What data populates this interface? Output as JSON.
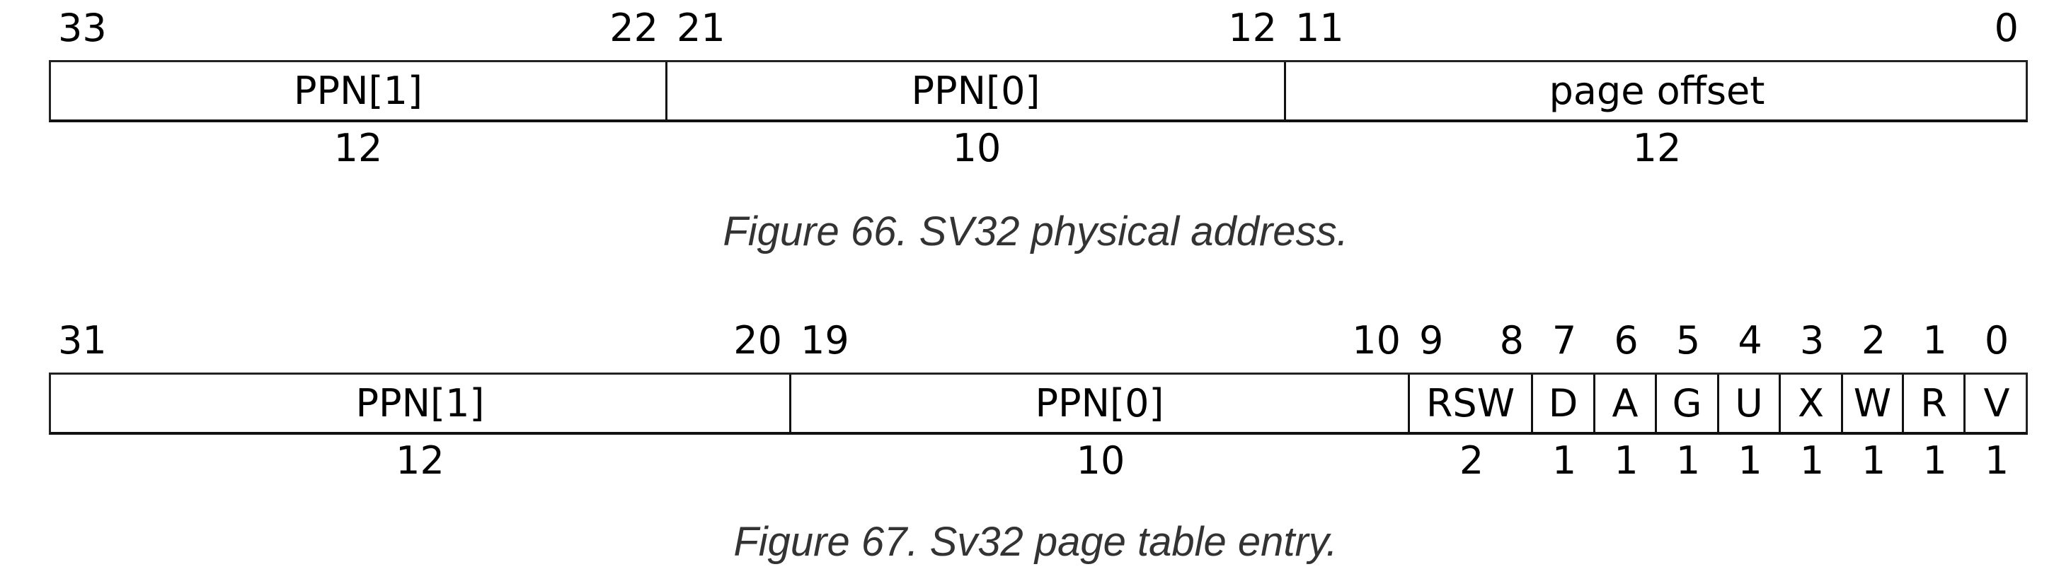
{
  "figures": [
    {
      "id": "fig66",
      "caption": "Figure 66. SV32 physical address.",
      "fields": [
        {
          "name": "PPN[1]",
          "msb": "33",
          "lsb": "22",
          "width": "12"
        },
        {
          "name": "PPN[0]",
          "msb": "21",
          "lsb": "12",
          "width": "10"
        },
        {
          "name": "page offset",
          "msb": "11",
          "lsb": "0",
          "width": "12"
        }
      ]
    },
    {
      "id": "fig67",
      "caption": "Figure 67. Sv32 page table entry.",
      "fields": [
        {
          "name": "PPN[1]",
          "msb": "31",
          "lsb": "20",
          "width": "12"
        },
        {
          "name": "PPN[0]",
          "msb": "19",
          "lsb": "10",
          "width": "10"
        },
        {
          "name": "RSW",
          "msb": "9",
          "lsb": "8",
          "width": "2"
        },
        {
          "name": "D",
          "msb": "7",
          "lsb": "7",
          "width": "1"
        },
        {
          "name": "A",
          "msb": "6",
          "lsb": "6",
          "width": "1"
        },
        {
          "name": "G",
          "msb": "5",
          "lsb": "5",
          "width": "1"
        },
        {
          "name": "U",
          "msb": "4",
          "lsb": "4",
          "width": "1"
        },
        {
          "name": "X",
          "msb": "3",
          "lsb": "3",
          "width": "1"
        },
        {
          "name": "W",
          "msb": "2",
          "lsb": "2",
          "width": "1"
        },
        {
          "name": "R",
          "msb": "1",
          "lsb": "1",
          "width": "1"
        },
        {
          "name": "V",
          "msb": "0",
          "lsb": "0",
          "width": "1"
        }
      ]
    }
  ]
}
